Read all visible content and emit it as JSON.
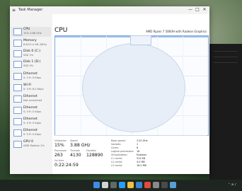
{
  "window": {
    "title": "Task Manager",
    "controls": [
      "—",
      "□",
      "✕"
    ]
  },
  "sidebar": {
    "items": [
      {
        "name": "CPU",
        "sub": "15% 3.88 GHz",
        "selected": true
      },
      {
        "name": "Memory",
        "sub": "8.6/15.4 GB (56%)"
      },
      {
        "name": "Disk 0 (C:)",
        "sub": "SSD 1%"
      },
      {
        "name": "Disk 1 (D:)",
        "sub": "SSD 0%"
      },
      {
        "name": "Ethernet",
        "sub": "S: 0  R: 0 Kbps"
      },
      {
        "name": "Wi-Fi",
        "sub": "S: 0  R: 8.0 Kbps"
      },
      {
        "name": "Ethernet",
        "sub": "Not connected"
      },
      {
        "name": "Ethernet",
        "sub": "S: 0  R: 0 Kbps"
      },
      {
        "name": "Ethernet",
        "sub": "S: 0  R: 0 Kbps"
      },
      {
        "name": "Ethernet",
        "sub": "S: 0  R: 0 Kbps"
      },
      {
        "name": "GPU 0",
        "sub": "AMD Radeon 2%"
      }
    ]
  },
  "main": {
    "title": "CPU",
    "model": "AMD Ryzen 7 5800H with Radeon Graphics",
    "stats": {
      "utilization_label": "Utilization",
      "utilization": "15%",
      "speed_label": "Speed",
      "speed": "3.88 GHz",
      "processes_label": "Processes",
      "processes": "263",
      "threads_label": "Threads",
      "threads": "4130",
      "handles_label": "Handles",
      "handles": "128890",
      "uptime_label": "Up time",
      "uptime": "0:22:24:59"
    },
    "right_stats": [
      {
        "label": "Base speed:",
        "value": "3.20 GHz"
      },
      {
        "label": "Sockets:",
        "value": "1"
      },
      {
        "label": "Cores:",
        "value": "8"
      },
      {
        "label": "Logical processors:",
        "value": "16"
      },
      {
        "label": "Virtualization:",
        "value": "Enabled"
      },
      {
        "label": "L1 cache:",
        "value": "512 KB"
      },
      {
        "label": "L2 cache:",
        "value": "4.0 MB"
      },
      {
        "label": "L3 cache:",
        "value": "16.0 MB"
      }
    ]
  },
  "colors": {
    "accent": "#7fa7dd",
    "window_bg": "#f3f3f3",
    "taskbar": "#1f2621"
  },
  "taskbar": {
    "icons": [
      "windows-start-icon",
      "search-icon",
      "taskview-icon",
      "edge-icon",
      "explorer-icon",
      "store-icon",
      "chrome-icon",
      "settings-icon",
      "terminal-icon",
      "task-manager-icon"
    ]
  }
}
